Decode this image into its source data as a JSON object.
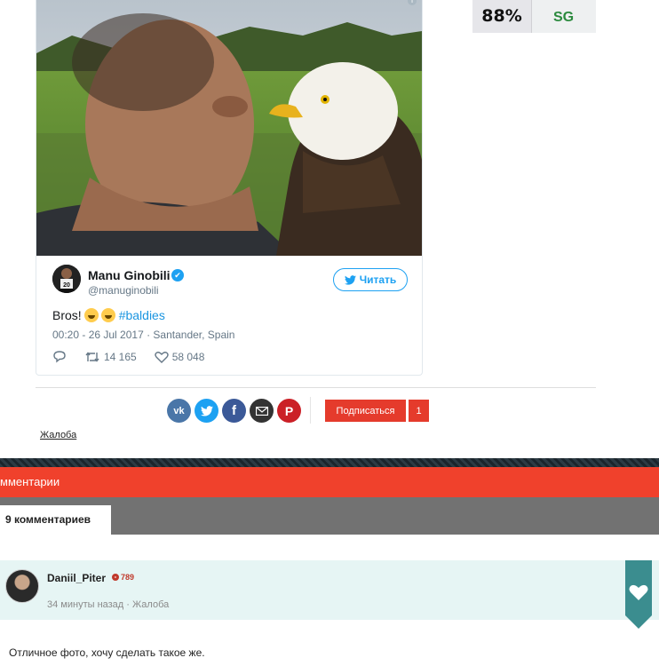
{
  "tweet": {
    "name": "Manu Ginobili",
    "handle": "@manuginobili",
    "follow_label": "Читать",
    "text": "Bros!",
    "hashtag": "#baldies",
    "meta": "00:20 - 26 Jul 2017 · Santander, Spain",
    "retweets": "14 165",
    "likes": "58 048",
    "avatar_jersey": "20"
  },
  "stat": {
    "percent": "88%",
    "team": "SG"
  },
  "share": {
    "networks": [
      "vk",
      "twitter",
      "facebook",
      "email",
      "pinterest"
    ],
    "subscribe_label": "Подписаться",
    "subscribe_count": "1"
  },
  "complaint_label": "Жалоба",
  "comments": {
    "header": "мментарии",
    "tab_label": "9 комментариев",
    "items": [
      {
        "author": "Daniil_Piter",
        "rating": "789",
        "time": "34 минуты назад",
        "complaint": "Жалоба",
        "text": "Отличное фото, хочу сделать такое же."
      }
    ]
  },
  "colors": {
    "accent_red": "#e53b2c",
    "twitter_blue": "#1da1f2",
    "comment_teal": "#3b8d8f"
  }
}
